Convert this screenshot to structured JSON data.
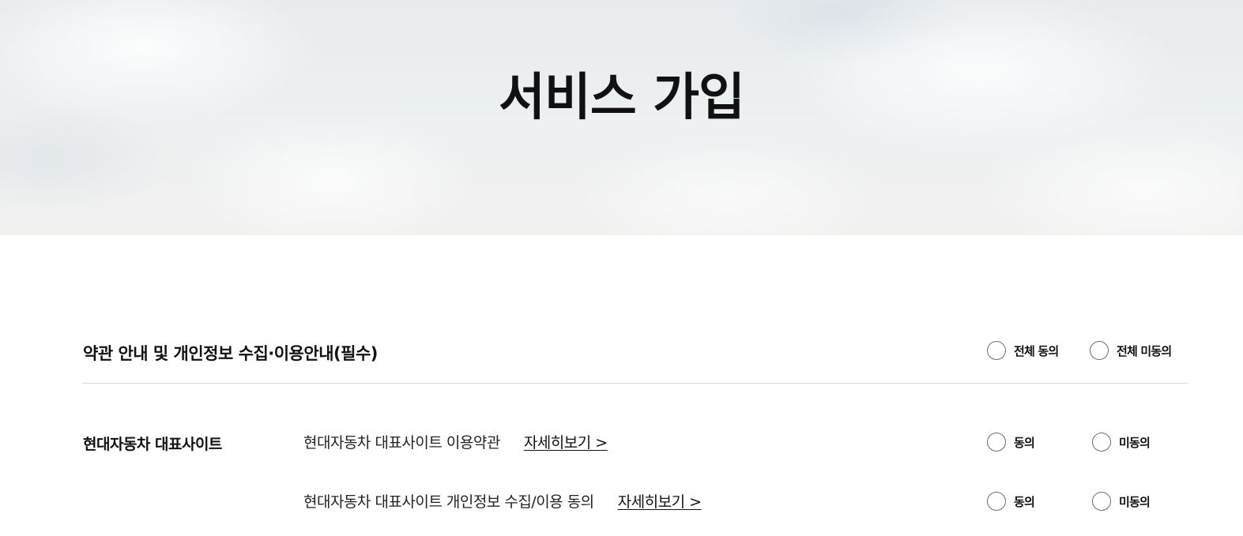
{
  "hero": {
    "title": "서비스 가입"
  },
  "terms_section": {
    "title": "약관 안내 및 개인정보 수집·이용안내(필수)",
    "agree_all_label": "전체 동의",
    "disagree_all_label": "전체 미동의"
  },
  "site_group": {
    "name": "현대자동차 대표사이트",
    "items": [
      {
        "text": "현대자동차 대표사이트 이용약관",
        "link_label": "자세히보기 >",
        "agree_label": "동의",
        "disagree_label": "미동의"
      },
      {
        "text": "현대자동차 대표사이트 개인정보 수집/이용 동의",
        "link_label": "자세히보기 >",
        "agree_label": "동의",
        "disagree_label": "미동의"
      }
    ]
  }
}
